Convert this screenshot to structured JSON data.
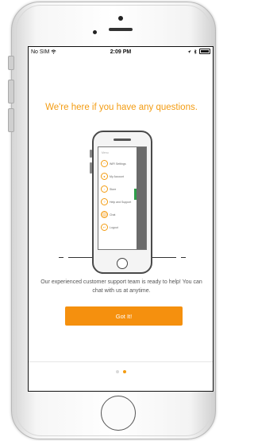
{
  "status_bar": {
    "carrier": "No SIM",
    "wifi_icon": "wifi-icon",
    "time": "2:09 PM",
    "icons": [
      "location-icon",
      "bluetooth-icon",
      "battery-icon"
    ]
  },
  "heading": "We're here if you have any questions.",
  "illustration": {
    "menu_title": "Menu",
    "menu_items": [
      {
        "label": "WiFi Settings",
        "icon": "wifi-icon",
        "active": false
      },
      {
        "label": "My Account",
        "icon": "user-icon",
        "active": false
      },
      {
        "label": "Store",
        "icon": "cart-icon",
        "active": false
      },
      {
        "label": "Help and Support",
        "icon": "question-icon",
        "active": false
      },
      {
        "label": "Chat",
        "icon": "chat-icon",
        "active": true
      },
      {
        "label": "Logout",
        "icon": "logout-icon",
        "active": false
      }
    ]
  },
  "description": "Our experienced customer support team is ready to help!  You can chat with us at anytime.",
  "got_it_button": "Got It!",
  "pager": {
    "current": 2,
    "total": 2
  },
  "colors": {
    "accent": "#f39c12",
    "button": "#f5900e",
    "dot_inactive": "#d9d9d9",
    "dot_active": "#f39c12"
  }
}
